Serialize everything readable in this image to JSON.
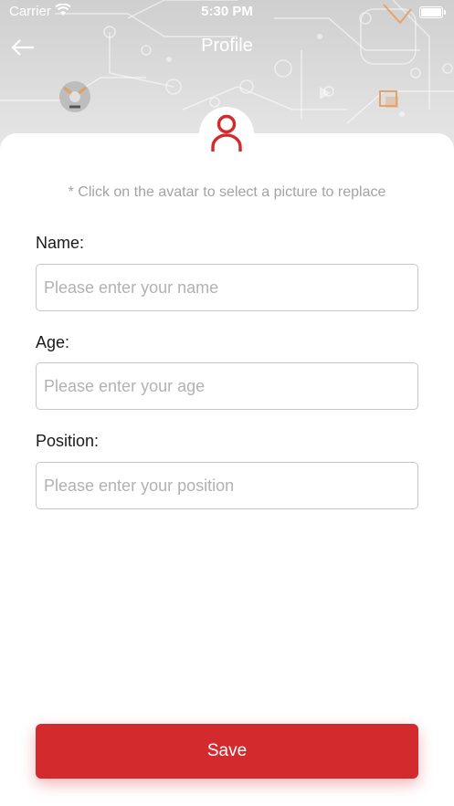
{
  "status_bar": {
    "carrier": "Carrier",
    "time": "5:30 PM",
    "wifi_icon": "wifi-icon",
    "battery_icon": "battery-icon"
  },
  "nav": {
    "title": "Profile",
    "back_icon": "arrow-left-icon"
  },
  "avatar": {
    "icon": "user-icon",
    "color": "#d32a2e"
  },
  "hint": "* Click on the avatar to select a picture to replace",
  "form": {
    "name": {
      "label": "Name:",
      "placeholder": "Please enter your name",
      "value": ""
    },
    "age": {
      "label": "Age:",
      "placeholder": "Please enter your age",
      "value": ""
    },
    "position": {
      "label": "Position:",
      "placeholder": "Please enter your position",
      "value": ""
    }
  },
  "save_label": "Save",
  "colors": {
    "accent": "#d32a2e",
    "hint_text": "#a3a3a3",
    "input_border": "#c6c6c6"
  }
}
